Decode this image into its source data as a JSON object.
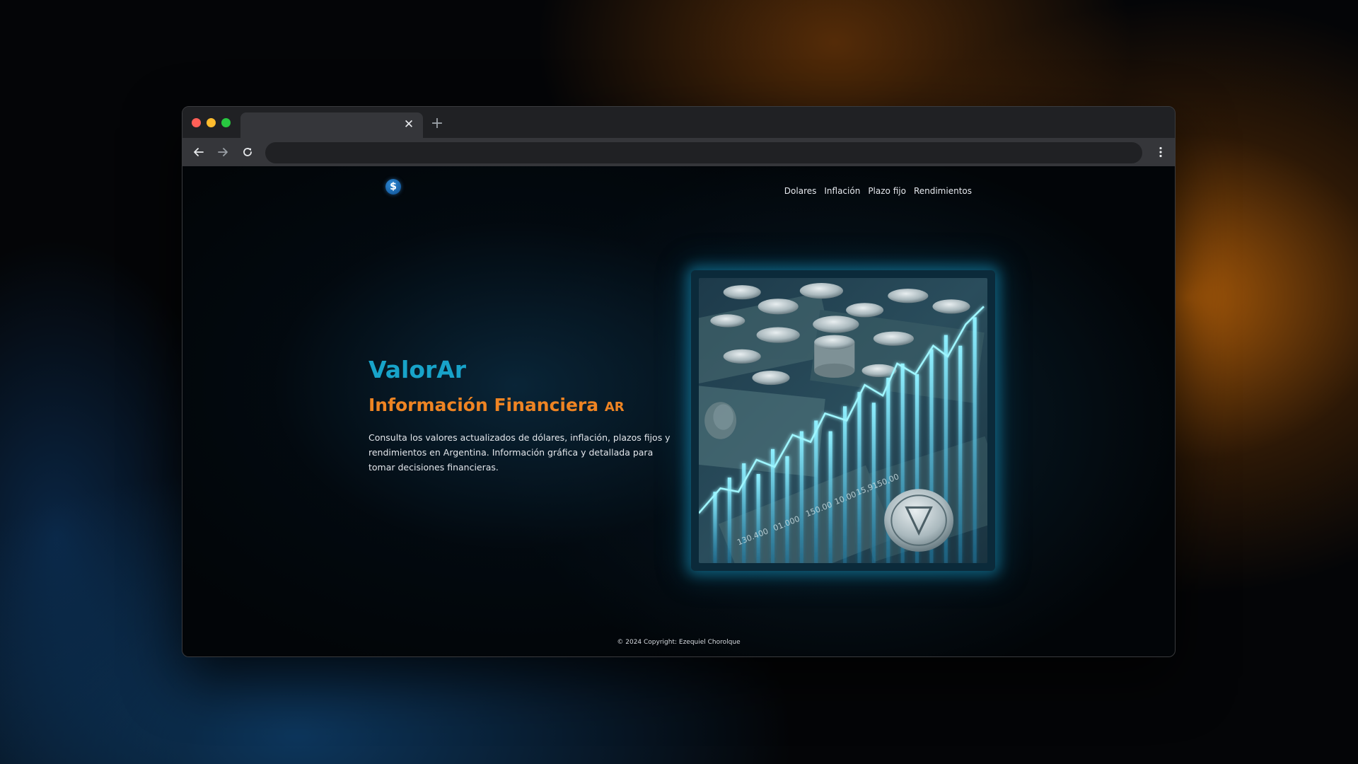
{
  "browser": {
    "tab_close_glyph": "✕",
    "new_tab_glyph": "+",
    "back_icon": "arrow-left-icon",
    "forward_icon": "arrow-right-icon",
    "reload_icon": "reload-icon",
    "menu_icon": "kebab-menu-icon",
    "url": ""
  },
  "site": {
    "logo_glyph": "$",
    "nav": [
      "Dolares",
      "Inflación",
      "Plazo fijo",
      "Rendimientos"
    ],
    "hero": {
      "title": "ValorAr",
      "subtitle": "Información Financiera",
      "subtitle_suffix": "AR",
      "description": "Consulta los valores actualizados de dólares, inflación, plazos fijos y rendimientos en Argentina. Información gráfica y detallada para tomar decisiones financieras.",
      "image_labels": [
        "130.400",
        "01.000",
        "150.00",
        "10.00",
        "15,9150,00"
      ]
    },
    "footer": "© 2024 Copyright: Ezequiel Chorolque"
  },
  "colors": {
    "title": "#18a3c9",
    "subtitle": "#ee8423",
    "glow": "#18a5d2",
    "page_background": "#020508"
  }
}
